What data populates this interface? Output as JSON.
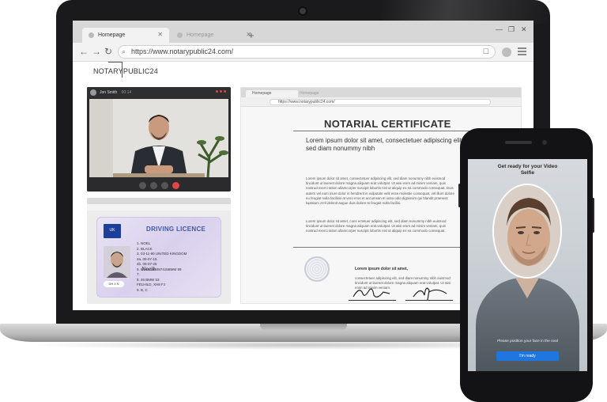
{
  "browser": {
    "tabs": [
      {
        "label": "Homepage",
        "active": true
      },
      {
        "label": "Homepage",
        "active": false
      }
    ],
    "new_tab_glyph": "+",
    "url": "https://www.notarypublic24.com/",
    "window_controls": [
      "—",
      "❐",
      "✕"
    ]
  },
  "site": {
    "logo": "NOTARYPUBLIC24"
  },
  "video_call": {
    "caller_name": "Jon Smith",
    "caller_meta": "00:14"
  },
  "licence": {
    "title": "DRIVING LICENCE",
    "eu_code": "UK",
    "fields": [
      "1. NOEL",
      "2. BLACK",
      "3. 03-11-90 UNITED KINGDOM",
      "4a. 05-07-15",
      "4b. 05-07-25",
      "5. NOEL965087415BMM 99",
      "7.",
      "8. 46 BMW 53",
      "   FELHILD, XH8 FJ",
      "9. B, C"
    ],
    "signature": "Noelh",
    "badge": "DH 4 N"
  },
  "certificate": {
    "mini_tab": "Homepage",
    "mini_tab2": "Homepage",
    "mini_url": "https://www.notarypublic24.com/",
    "title": "NOTARIAL CERTIFICATE",
    "lead": "Lorem ipsum dolor sit amet, consectetuer adipiscing elit, sed diam nonummy nibh",
    "para1": "Lorem ipsum dolor sit amet, consectetuer adipiscing elit, sed diam nonummy nibh euismod tincidunt ut laoreet dolore magna aliquam erat volutpat. Ut wisi enim ad minim veniam, quis nostrud exerci tation ullamcorper suscipit lobortis nisl ut aliquip ex ea commodo consequat. Duis autem vel eum iriure dolor in hendrerit in vulputate velit esse molestie consequat, vel illum dolore eu feugiat nulla facilisis at vero eros et accumsan et iusto odio dignissim qui blandit praesent luptatum zzril delenit augue duis dolore te feugait nulla facilisi.",
    "para2": "Lorem ipsum dolor sit amet, cons ectetuer adipiscing elit, sed diam nonummy nibh euismod tincidunt ut laoreet dolore magna aliquam erat volutpat. Ut wisi enim ad minim veniam, quis nostrud exerci tation ullamcorper suscipit lobortis nisl ut aliquip ex ea commodo consequat.",
    "sig_heading": "Lorem ipsum dolor sit amet,",
    "sig_text": "consectetuer adipiscing elit, sed diam nonummy nibh euismod tincidunt ut laoreet dolore magna aliquam erat volutpat. Ut wisi enim ad minim veniam."
  },
  "phone": {
    "heading": "Get ready for your Video Selfie",
    "instruction": "Please position your face in the oval",
    "button": "I'm ready"
  },
  "colors": {
    "accent_blue": "#1f76e0",
    "licence_blue": "#3d5aa8",
    "end_call_red": "#e04646"
  }
}
